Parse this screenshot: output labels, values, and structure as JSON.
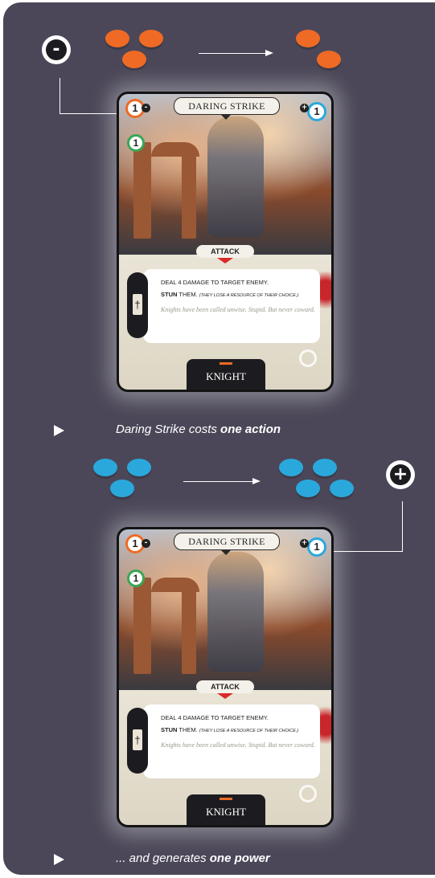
{
  "colors": {
    "panel_bg": "#4b4758",
    "action_token": "#ef6a24",
    "power_token": "#2aa8dc",
    "green_badge": "#3aa657",
    "card_frame": "#141414"
  },
  "step1": {
    "operator_symbol": "-",
    "tokens_before": 3,
    "tokens_after": 2,
    "token_icon": "lightning-bolt-icon"
  },
  "step2": {
    "operator_symbol": "+",
    "tokens_before": 3,
    "tokens_after": 4,
    "token_icon": "paper-plane-icon"
  },
  "card": {
    "title": "DARING STRIKE",
    "cost": "1",
    "cost_sign": "-",
    "generates": "1",
    "generates_sign": "+",
    "green_value": "1",
    "type": "ATTACK",
    "effect_line1": "DEAL 4 DAMAGE TO TARGET ENEMY.",
    "effect_line2_bold": "STUN",
    "effect_line2_rest": " THEM.",
    "effect_line2_note": "(THEY LOSE A RESOURCE OF THEIR CHOICE.)",
    "flavor": "Knights have been called unwise. Stupid. But never coward.",
    "class": "KNIGHT",
    "type_icon": "sword-icon"
  },
  "caption1": {
    "prefix": "Daring Strike costs ",
    "bold": "one action"
  },
  "caption2": {
    "prefix": "... and generates ",
    "bold": "one power"
  }
}
